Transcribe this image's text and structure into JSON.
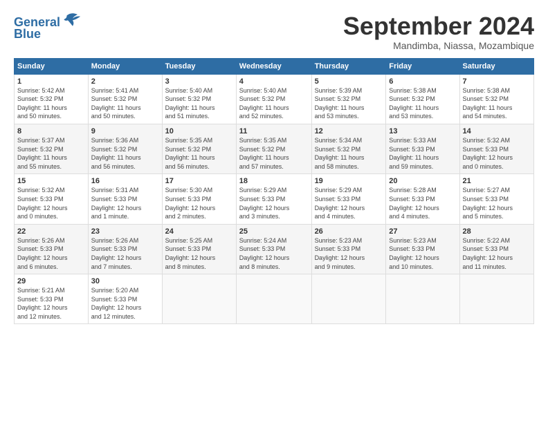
{
  "logo": {
    "line1": "General",
    "line2": "Blue"
  },
  "header": {
    "month": "September 2024",
    "location": "Mandimba, Niassa, Mozambique"
  },
  "weekdays": [
    "Sunday",
    "Monday",
    "Tuesday",
    "Wednesday",
    "Thursday",
    "Friday",
    "Saturday"
  ],
  "weeks": [
    [
      {
        "day": "1",
        "sunrise": "Sunrise: 5:42 AM",
        "sunset": "Sunset: 5:32 PM",
        "daylight": "Daylight: 11 hours and 50 minutes."
      },
      {
        "day": "2",
        "sunrise": "Sunrise: 5:41 AM",
        "sunset": "Sunset: 5:32 PM",
        "daylight": "Daylight: 11 hours and 50 minutes."
      },
      {
        "day": "3",
        "sunrise": "Sunrise: 5:40 AM",
        "sunset": "Sunset: 5:32 PM",
        "daylight": "Daylight: 11 hours and 51 minutes."
      },
      {
        "day": "4",
        "sunrise": "Sunrise: 5:40 AM",
        "sunset": "Sunset: 5:32 PM",
        "daylight": "Daylight: 11 hours and 52 minutes."
      },
      {
        "day": "5",
        "sunrise": "Sunrise: 5:39 AM",
        "sunset": "Sunset: 5:32 PM",
        "daylight": "Daylight: 11 hours and 53 minutes."
      },
      {
        "day": "6",
        "sunrise": "Sunrise: 5:38 AM",
        "sunset": "Sunset: 5:32 PM",
        "daylight": "Daylight: 11 hours and 53 minutes."
      },
      {
        "day": "7",
        "sunrise": "Sunrise: 5:38 AM",
        "sunset": "Sunset: 5:32 PM",
        "daylight": "Daylight: 11 hours and 54 minutes."
      }
    ],
    [
      {
        "day": "8",
        "sunrise": "Sunrise: 5:37 AM",
        "sunset": "Sunset: 5:32 PM",
        "daylight": "Daylight: 11 hours and 55 minutes."
      },
      {
        "day": "9",
        "sunrise": "Sunrise: 5:36 AM",
        "sunset": "Sunset: 5:32 PM",
        "daylight": "Daylight: 11 hours and 56 minutes."
      },
      {
        "day": "10",
        "sunrise": "Sunrise: 5:35 AM",
        "sunset": "Sunset: 5:32 PM",
        "daylight": "Daylight: 11 hours and 56 minutes."
      },
      {
        "day": "11",
        "sunrise": "Sunrise: 5:35 AM",
        "sunset": "Sunset: 5:32 PM",
        "daylight": "Daylight: 11 hours and 57 minutes."
      },
      {
        "day": "12",
        "sunrise": "Sunrise: 5:34 AM",
        "sunset": "Sunset: 5:32 PM",
        "daylight": "Daylight: 11 hours and 58 minutes."
      },
      {
        "day": "13",
        "sunrise": "Sunrise: 5:33 AM",
        "sunset": "Sunset: 5:33 PM",
        "daylight": "Daylight: 11 hours and 59 minutes."
      },
      {
        "day": "14",
        "sunrise": "Sunrise: 5:32 AM",
        "sunset": "Sunset: 5:33 PM",
        "daylight": "Daylight: 12 hours and 0 minutes."
      }
    ],
    [
      {
        "day": "15",
        "sunrise": "Sunrise: 5:32 AM",
        "sunset": "Sunset: 5:33 PM",
        "daylight": "Daylight: 12 hours and 0 minutes."
      },
      {
        "day": "16",
        "sunrise": "Sunrise: 5:31 AM",
        "sunset": "Sunset: 5:33 PM",
        "daylight": "Daylight: 12 hours and 1 minute."
      },
      {
        "day": "17",
        "sunrise": "Sunrise: 5:30 AM",
        "sunset": "Sunset: 5:33 PM",
        "daylight": "Daylight: 12 hours and 2 minutes."
      },
      {
        "day": "18",
        "sunrise": "Sunrise: 5:29 AM",
        "sunset": "Sunset: 5:33 PM",
        "daylight": "Daylight: 12 hours and 3 minutes."
      },
      {
        "day": "19",
        "sunrise": "Sunrise: 5:29 AM",
        "sunset": "Sunset: 5:33 PM",
        "daylight": "Daylight: 12 hours and 4 minutes."
      },
      {
        "day": "20",
        "sunrise": "Sunrise: 5:28 AM",
        "sunset": "Sunset: 5:33 PM",
        "daylight": "Daylight: 12 hours and 4 minutes."
      },
      {
        "day": "21",
        "sunrise": "Sunrise: 5:27 AM",
        "sunset": "Sunset: 5:33 PM",
        "daylight": "Daylight: 12 hours and 5 minutes."
      }
    ],
    [
      {
        "day": "22",
        "sunrise": "Sunrise: 5:26 AM",
        "sunset": "Sunset: 5:33 PM",
        "daylight": "Daylight: 12 hours and 6 minutes."
      },
      {
        "day": "23",
        "sunrise": "Sunrise: 5:26 AM",
        "sunset": "Sunset: 5:33 PM",
        "daylight": "Daylight: 12 hours and 7 minutes."
      },
      {
        "day": "24",
        "sunrise": "Sunrise: 5:25 AM",
        "sunset": "Sunset: 5:33 PM",
        "daylight": "Daylight: 12 hours and 8 minutes."
      },
      {
        "day": "25",
        "sunrise": "Sunrise: 5:24 AM",
        "sunset": "Sunset: 5:33 PM",
        "daylight": "Daylight: 12 hours and 8 minutes."
      },
      {
        "day": "26",
        "sunrise": "Sunrise: 5:23 AM",
        "sunset": "Sunset: 5:33 PM",
        "daylight": "Daylight: 12 hours and 9 minutes."
      },
      {
        "day": "27",
        "sunrise": "Sunrise: 5:23 AM",
        "sunset": "Sunset: 5:33 PM",
        "daylight": "Daylight: 12 hours and 10 minutes."
      },
      {
        "day": "28",
        "sunrise": "Sunrise: 5:22 AM",
        "sunset": "Sunset: 5:33 PM",
        "daylight": "Daylight: 12 hours and 11 minutes."
      }
    ],
    [
      {
        "day": "29",
        "sunrise": "Sunrise: 5:21 AM",
        "sunset": "Sunset: 5:33 PM",
        "daylight": "Daylight: 12 hours and 12 minutes."
      },
      {
        "day": "30",
        "sunrise": "Sunrise: 5:20 AM",
        "sunset": "Sunset: 5:33 PM",
        "daylight": "Daylight: 12 hours and 12 minutes."
      },
      null,
      null,
      null,
      null,
      null
    ]
  ]
}
